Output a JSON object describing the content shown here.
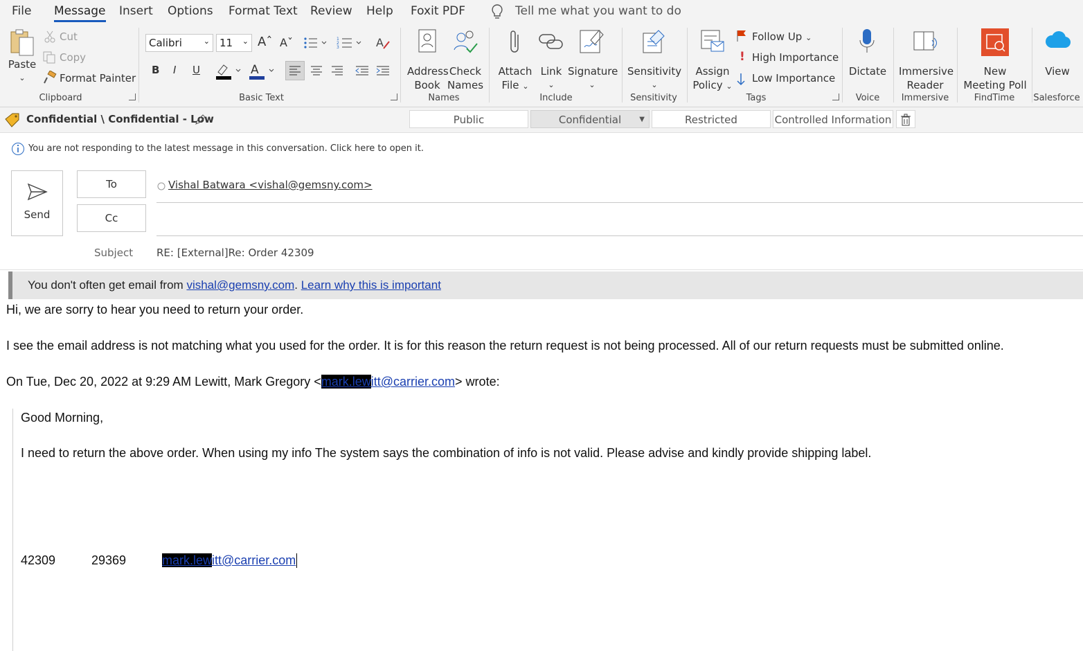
{
  "menu": {
    "items": [
      "File",
      "Message",
      "Insert",
      "Options",
      "Format Text",
      "Review",
      "Help",
      "Foxit PDF"
    ],
    "active": "Message",
    "tell_me": "Tell me what you want to do"
  },
  "ribbon": {
    "clipboard": {
      "paste": "Paste",
      "cut": "Cut",
      "copy": "Copy",
      "format_painter": "Format Painter",
      "label": "Clipboard"
    },
    "basic_text": {
      "font": "Calibri",
      "size": "11",
      "bold": "B",
      "italic": "I",
      "underline": "U",
      "label": "Basic Text"
    },
    "names": {
      "address_book_1": "Address",
      "address_book_2": "Book",
      "check_names_1": "Check",
      "check_names_2": "Names",
      "label": "Names"
    },
    "include": {
      "attach_1": "Attach",
      "attach_2": "File",
      "link": "Link",
      "signature": "Signature",
      "label": "Include"
    },
    "sensitivity": {
      "button": "Sensitivity",
      "label": "Sensitivity"
    },
    "tags": {
      "assign_1": "Assign",
      "assign_2": "Policy",
      "follow_up": "Follow Up",
      "high": "High Importance",
      "low": "Low Importance",
      "label": "Tags"
    },
    "voice": {
      "dictate": "Dictate",
      "label": "Voice"
    },
    "immersive": {
      "reader_1": "Immersive",
      "reader_2": "Reader",
      "label": "Immersive"
    },
    "findtime": {
      "poll_1": "New",
      "poll_2": "Meeting Poll",
      "label": "FindTime"
    },
    "salesforce": {
      "view": "View",
      "label": "Salesforce"
    }
  },
  "sensitivity_bar": {
    "label": "Confidential \\ Confidential - Low",
    "options": [
      "Public",
      "Confidential",
      "Restricted",
      "Controlled Information"
    ],
    "selected": "Confidential"
  },
  "info_bar": "You are not responding to the latest message in this conversation. Click here to open it.",
  "compose": {
    "send": "Send",
    "to_label": "To",
    "cc_label": "Cc",
    "to_value": "Vishal Batwara <vishal@gemsny.com>",
    "subject_label": "Subject",
    "subject_value": "RE: [External]Re: Order 42309"
  },
  "external_banner": {
    "prefix": "You don't often get email from ",
    "sender": "vishal@gemsny.com",
    "sep": ". ",
    "link": "Learn why this is important"
  },
  "body": {
    "line1": "Hi, we are sorry to hear you need to return your order.",
    "line2": "I see the email address is not matching what you used for the order. It is for this reason the return request is not being processed. All of our return requests must be submitted online.",
    "quote_prefix": "On Tue, Dec 20, 2022 at 9:29 AM Lewitt, Mark Gregory <",
    "quote_email_redacted": "mark.lew",
    "quote_email_rest": "itt@carrier.com",
    "quote_suffix": "> wrote:",
    "quoted_greeting": "Good Morning,",
    "quoted_line": "I need to return the above order. When using my info The system says the combination of info is not valid. Please advise and kindly provide shipping label.",
    "order_number": "42309",
    "zip": "29369",
    "email_redacted": "mark.lew",
    "email_rest": "itt@carrier.com"
  }
}
